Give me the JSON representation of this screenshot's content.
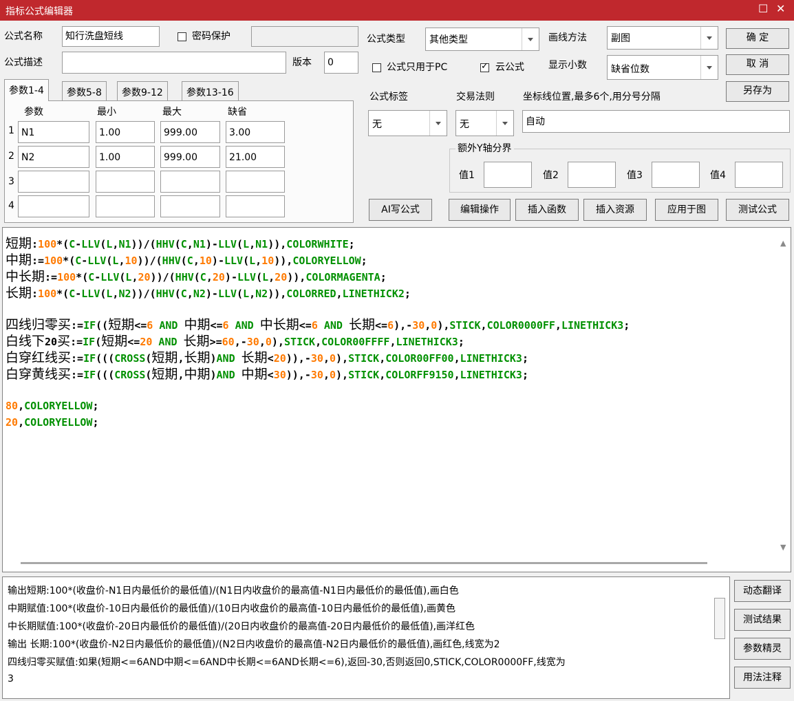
{
  "window": {
    "title": "指标公式编辑器"
  },
  "form": {
    "name_label": "公式名称",
    "name_value": "知行洗盘短线",
    "password_label": "密码保护",
    "desc_label": "公式描述",
    "desc_value": "",
    "version_label": "版本",
    "version_value": "0",
    "type_label": "公式类型",
    "type_value": "其他类型",
    "draw_label": "画线方法",
    "draw_value": "副图",
    "pc_only_label": "公式只用于PC",
    "cloud_label": "云公式",
    "decimal_label": "显示小数",
    "decimal_value": "缺省位数",
    "tag_label": "公式标签",
    "tag_value": "无",
    "rule_label": "交易法则",
    "rule_value": "无",
    "axis_label": "坐标线位置,最多6个,用分号分隔",
    "axis_value": "自动",
    "extra_y_label": "额外Y轴分界",
    "y_labels": [
      "值1",
      "值2",
      "值3",
      "值4"
    ]
  },
  "buttons": {
    "ok": "确 定",
    "cancel": "取 消",
    "save_as": "另存为",
    "ai": "AI写公式",
    "edit_ops": "编辑操作",
    "insert_func": "插入函数",
    "insert_res": "插入资源",
    "apply": "应用于图",
    "test": "测试公式"
  },
  "params": {
    "tabs": [
      "参数1-4",
      "参数5-8",
      "参数9-12",
      "参数13-16"
    ],
    "headers": [
      "参数",
      "最小",
      "最大",
      "缺省"
    ],
    "rows": [
      {
        "idx": "1",
        "name": "N1",
        "min": "1.00",
        "max": "999.00",
        "def": "3.00"
      },
      {
        "idx": "2",
        "name": "N2",
        "min": "1.00",
        "max": "999.00",
        "def": "21.00"
      },
      {
        "idx": "3",
        "name": "",
        "min": "",
        "max": "",
        "def": ""
      },
      {
        "idx": "4",
        "name": "",
        "min": "",
        "max": "",
        "def": ""
      }
    ]
  },
  "code_lines": [
    [
      [
        "cn",
        "短期"
      ],
      [
        "o",
        ":"
      ],
      [
        "n",
        "100"
      ],
      [
        "o",
        "*("
      ],
      [
        "k",
        "C"
      ],
      [
        "o",
        "-"
      ],
      [
        "k",
        "LLV"
      ],
      [
        "o",
        "("
      ],
      [
        "k",
        "L"
      ],
      [
        "o",
        ","
      ],
      [
        "k",
        "N1"
      ],
      [
        "o",
        "))/("
      ],
      [
        "k",
        "HHV"
      ],
      [
        "o",
        "("
      ],
      [
        "k",
        "C"
      ],
      [
        "o",
        ","
      ],
      [
        "k",
        "N1"
      ],
      [
        "o",
        ")-"
      ],
      [
        "k",
        "LLV"
      ],
      [
        "o",
        "("
      ],
      [
        "k",
        "L"
      ],
      [
        "o",
        ","
      ],
      [
        "k",
        "N1"
      ],
      [
        "o",
        "))"
      ],
      [
        "o",
        ","
      ],
      [
        "k",
        "COLORWHITE"
      ],
      [
        "o",
        ";"
      ]
    ],
    [
      [
        "cn",
        "中期"
      ],
      [
        "o",
        ":="
      ],
      [
        "n",
        "100"
      ],
      [
        "o",
        "*("
      ],
      [
        "k",
        "C"
      ],
      [
        "o",
        "-"
      ],
      [
        "k",
        "LLV"
      ],
      [
        "o",
        "("
      ],
      [
        "k",
        "L"
      ],
      [
        "o",
        ","
      ],
      [
        "n",
        "10"
      ],
      [
        "o",
        "))/("
      ],
      [
        "k",
        "HHV"
      ],
      [
        "o",
        "("
      ],
      [
        "k",
        "C"
      ],
      [
        "o",
        ","
      ],
      [
        "n",
        "10"
      ],
      [
        "o",
        ")-"
      ],
      [
        "k",
        "LLV"
      ],
      [
        "o",
        "("
      ],
      [
        "k",
        "L"
      ],
      [
        "o",
        ","
      ],
      [
        "n",
        "10"
      ],
      [
        "o",
        "))"
      ],
      [
        "o",
        ","
      ],
      [
        "k",
        "COLORYELLOW"
      ],
      [
        "o",
        ";"
      ]
    ],
    [
      [
        "cn",
        "中长期"
      ],
      [
        "o",
        ":="
      ],
      [
        "n",
        "100"
      ],
      [
        "o",
        "*("
      ],
      [
        "k",
        "C"
      ],
      [
        "o",
        "-"
      ],
      [
        "k",
        "LLV"
      ],
      [
        "o",
        "("
      ],
      [
        "k",
        "L"
      ],
      [
        "o",
        ","
      ],
      [
        "n",
        "20"
      ],
      [
        "o",
        "))/("
      ],
      [
        "k",
        "HHV"
      ],
      [
        "o",
        "("
      ],
      [
        "k",
        "C"
      ],
      [
        "o",
        ","
      ],
      [
        "n",
        "20"
      ],
      [
        "o",
        ")-"
      ],
      [
        "k",
        "LLV"
      ],
      [
        "o",
        "("
      ],
      [
        "k",
        "L"
      ],
      [
        "o",
        ","
      ],
      [
        "n",
        "20"
      ],
      [
        "o",
        "))"
      ],
      [
        "o",
        ","
      ],
      [
        "k",
        "COLORMAGENTA"
      ],
      [
        "o",
        ";"
      ]
    ],
    [
      [
        "cn",
        "长期"
      ],
      [
        "o",
        ":"
      ],
      [
        "n",
        "100"
      ],
      [
        "o",
        "*("
      ],
      [
        "k",
        "C"
      ],
      [
        "o",
        "-"
      ],
      [
        "k",
        "LLV"
      ],
      [
        "o",
        "("
      ],
      [
        "k",
        "L"
      ],
      [
        "o",
        ","
      ],
      [
        "k",
        "N2"
      ],
      [
        "o",
        "))/("
      ],
      [
        "k",
        "HHV"
      ],
      [
        "o",
        "("
      ],
      [
        "k",
        "C"
      ],
      [
        "o",
        ","
      ],
      [
        "k",
        "N2"
      ],
      [
        "o",
        ")-"
      ],
      [
        "k",
        "LLV"
      ],
      [
        "o",
        "("
      ],
      [
        "k",
        "L"
      ],
      [
        "o",
        ","
      ],
      [
        "k",
        "N2"
      ],
      [
        "o",
        "))"
      ],
      [
        "o",
        ","
      ],
      [
        "k",
        "COLORRED"
      ],
      [
        "o",
        ","
      ],
      [
        "k",
        "LINETHICK2"
      ],
      [
        "o",
        ";"
      ]
    ],
    [],
    [
      [
        "cn",
        "四线归零买"
      ],
      [
        "o",
        ":="
      ],
      [
        "k",
        "IF"
      ],
      [
        "o",
        "(("
      ],
      [
        "cn",
        "短期"
      ],
      [
        "o",
        "<="
      ],
      [
        "n",
        "6"
      ],
      [
        "o",
        " "
      ],
      [
        "k",
        "AND"
      ],
      [
        "o",
        " "
      ],
      [
        "cn",
        "中期"
      ],
      [
        "o",
        "<="
      ],
      [
        "n",
        "6"
      ],
      [
        "o",
        " "
      ],
      [
        "k",
        "AND"
      ],
      [
        "o",
        " "
      ],
      [
        "cn",
        "中长期"
      ],
      [
        "o",
        "<="
      ],
      [
        "n",
        "6"
      ],
      [
        "o",
        " "
      ],
      [
        "k",
        "AND"
      ],
      [
        "o",
        " "
      ],
      [
        "cn",
        "长期"
      ],
      [
        "o",
        "<="
      ],
      [
        "n",
        "6"
      ],
      [
        "o",
        "),-"
      ],
      [
        "n",
        "30"
      ],
      [
        "o",
        ","
      ],
      [
        "n",
        "0"
      ],
      [
        "o",
        "),"
      ],
      [
        "k",
        "STICK"
      ],
      [
        "o",
        ","
      ],
      [
        "k",
        "COLOR0000FF"
      ],
      [
        "o",
        ","
      ],
      [
        "k",
        "LINETHICK3"
      ],
      [
        "o",
        ";"
      ]
    ],
    [
      [
        "cn",
        "白线下"
      ],
      [
        "o",
        "20"
      ],
      [
        "cn",
        "买"
      ],
      [
        "o",
        ":="
      ],
      [
        "k",
        "IF"
      ],
      [
        "o",
        "("
      ],
      [
        "cn",
        "短期"
      ],
      [
        "o",
        "<="
      ],
      [
        "n",
        "20"
      ],
      [
        "o",
        " "
      ],
      [
        "k",
        "AND"
      ],
      [
        "o",
        " "
      ],
      [
        "cn",
        "长期"
      ],
      [
        "o",
        ">="
      ],
      [
        "n",
        "60"
      ],
      [
        "o",
        ",-"
      ],
      [
        "n",
        "30"
      ],
      [
        "o",
        ","
      ],
      [
        "n",
        "0"
      ],
      [
        "o",
        "),"
      ],
      [
        "k",
        "STICK"
      ],
      [
        "o",
        ","
      ],
      [
        "k",
        "COLOR00FFFF"
      ],
      [
        "o",
        ","
      ],
      [
        "k",
        "LINETHICK3"
      ],
      [
        "o",
        ";"
      ]
    ],
    [
      [
        "cn",
        "白穿红线买"
      ],
      [
        "o",
        ":="
      ],
      [
        "k",
        "IF"
      ],
      [
        "o",
        "((("
      ],
      [
        "k",
        "CROSS"
      ],
      [
        "o",
        "("
      ],
      [
        "cn",
        "短期"
      ],
      [
        "o",
        ","
      ],
      [
        "cn",
        "长期"
      ],
      [
        "o",
        ")"
      ],
      [
        "k",
        "AND"
      ],
      [
        "o",
        " "
      ],
      [
        "cn",
        "长期"
      ],
      [
        "o",
        "<"
      ],
      [
        "n",
        "20"
      ],
      [
        "o",
        ")),-"
      ],
      [
        "n",
        "30"
      ],
      [
        "o",
        ","
      ],
      [
        "n",
        "0"
      ],
      [
        "o",
        "),"
      ],
      [
        "k",
        "STICK"
      ],
      [
        "o",
        ","
      ],
      [
        "k",
        "COLOR00FF00"
      ],
      [
        "o",
        ","
      ],
      [
        "k",
        "LINETHICK3"
      ],
      [
        "o",
        ";"
      ]
    ],
    [
      [
        "cn",
        "白穿黄线买"
      ],
      [
        "o",
        ":="
      ],
      [
        "k",
        "IF"
      ],
      [
        "o",
        "((("
      ],
      [
        "k",
        "CROSS"
      ],
      [
        "o",
        "("
      ],
      [
        "cn",
        "短期"
      ],
      [
        "o",
        ","
      ],
      [
        "cn",
        "中期"
      ],
      [
        "o",
        ")"
      ],
      [
        "k",
        "AND"
      ],
      [
        "o",
        " "
      ],
      [
        "cn",
        "中期"
      ],
      [
        "o",
        "<"
      ],
      [
        "n",
        "30"
      ],
      [
        "o",
        ")),-"
      ],
      [
        "n",
        "30"
      ],
      [
        "o",
        ","
      ],
      [
        "n",
        "0"
      ],
      [
        "o",
        "),"
      ],
      [
        "k",
        "STICK"
      ],
      [
        "o",
        ","
      ],
      [
        "k",
        "COLORFF9150"
      ],
      [
        "o",
        ","
      ],
      [
        "k",
        "LINETHICK3"
      ],
      [
        "o",
        ";"
      ]
    ],
    [],
    [
      [
        "n",
        "80"
      ],
      [
        "o",
        ","
      ],
      [
        "k",
        "COLORYELLOW"
      ],
      [
        "o",
        ";"
      ]
    ],
    [
      [
        "n",
        "20"
      ],
      [
        "o",
        ","
      ],
      [
        "k",
        "COLORYELLOW"
      ],
      [
        "o",
        ";"
      ]
    ]
  ],
  "description_lines": [
    "输出短期:100*(收盘价-N1日内最低价的最低值)/(N1日内收盘价的最高值-N1日内最低价的最低值),画白色",
    "中期赋值:100*(收盘价-10日内最低价的最低值)/(10日内收盘价的最高值-10日内最低价的最低值),画黄色",
    "中长期赋值:100*(收盘价-20日内最低价的最低值)/(20日内收盘价的最高值-20日内最低价的最低值),画洋红色",
    "输出 长期:100*(收盘价-N2日内最低价的最低值)/(N2日内收盘价的最高值-N2日内最低价的最低值),画红色,线宽为2",
    "四线归零买赋值:如果(短期<=6AND中期<=6AND中长期<=6AND长期<=6),返回-30,否则返回0,STICK,COLOR0000FF,线宽为",
    "3"
  ],
  "side_buttons": [
    "动态翻译",
    "测试结果",
    "参数精灵",
    "用法注释"
  ]
}
